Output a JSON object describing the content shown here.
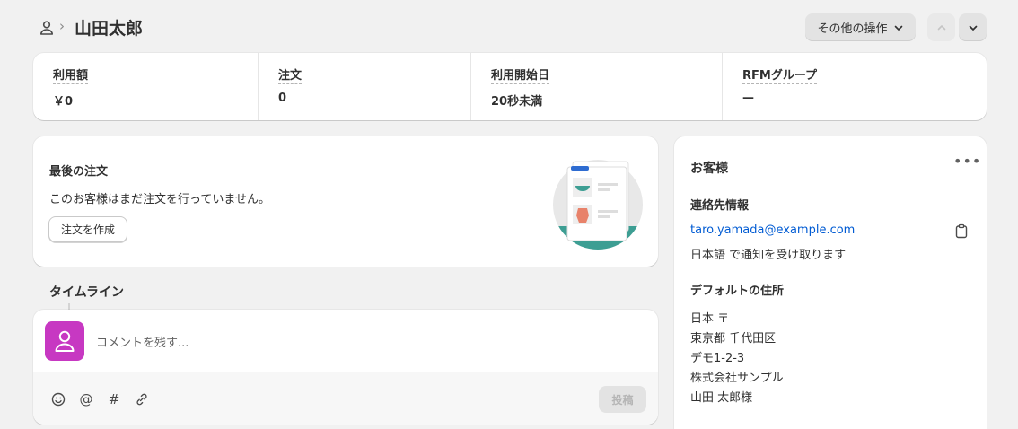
{
  "header": {
    "title": "山田太郎",
    "more_actions_label": "その他の操作"
  },
  "stats": [
    {
      "label": "利用額",
      "value": "￥0"
    },
    {
      "label": "注文",
      "value": "0"
    },
    {
      "label": "利用開始日",
      "value": "20秒未満"
    },
    {
      "label": "RFMグループ",
      "value": "—"
    }
  ],
  "last_order": {
    "title": "最後の注文",
    "message": "このお客様はまだ注文を行っていません。",
    "create_button": "注文を作成"
  },
  "timeline": {
    "title": "タイムライン",
    "comment_placeholder": "コメントを残す...",
    "post_button": "投稿",
    "tools": [
      "emoji-icon",
      "mention-icon",
      "hashtag-icon",
      "attachment-icon"
    ]
  },
  "customer": {
    "title": "お客様",
    "contact_title": "連絡先情報",
    "email": "taro.yamada@example.com",
    "language_note": "日本語 で通知を受け取ります",
    "address_title": "デフォルトの住所",
    "address_lines": [
      "日本 〒",
      "東京都 千代田区",
      "デモ1-2-3",
      "株式会社サンプル",
      "山田 太郎様"
    ]
  },
  "colors": {
    "avatar_bg": "#c738c2",
    "link": "#005bd3",
    "illustration_teal": "#3d9e93"
  }
}
